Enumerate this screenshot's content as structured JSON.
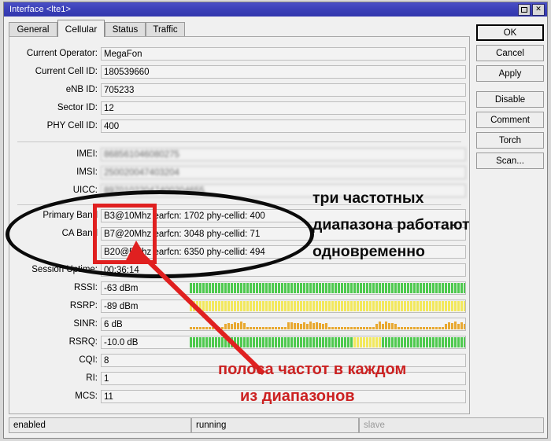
{
  "window": {
    "title": "Interface <lte1>",
    "controls": [
      {
        "name": "maximize",
        "glyph": "□"
      },
      {
        "name": "close",
        "glyph": "✕"
      }
    ]
  },
  "tabs": [
    {
      "label": "General",
      "active": false
    },
    {
      "label": "Cellular",
      "active": true
    },
    {
      "label": "Status",
      "active": false
    },
    {
      "label": "Traffic",
      "active": false
    }
  ],
  "fields": [
    {
      "label": "Current Operator:",
      "value": "MegaFon",
      "blurred": false
    },
    {
      "label": "Current Cell ID:",
      "value": "180539660",
      "blurred": false
    },
    {
      "label": "eNB ID:",
      "value": "705233",
      "blurred": false
    },
    {
      "label": "Sector ID:",
      "value": "12",
      "blurred": false
    },
    {
      "label": "PHY Cell ID:",
      "value": "400",
      "blurred": false
    },
    {
      "label": "IMEI:",
      "value": "868561046080275",
      "blurred": true
    },
    {
      "label": "IMSI:",
      "value": "250020047403204",
      "blurred": true
    },
    {
      "label": "UICC:",
      "value": "89701022047400204655",
      "blurred": true
    }
  ],
  "bands": [
    {
      "label": "Primary Band",
      "value": "B3@10Mhz earfcn: 1702 phy-cellid: 400"
    },
    {
      "label": "CA Band",
      "value": "B7@20Mhz earfcn: 3048 phy-cellid: 71"
    },
    {
      "label": "",
      "value": "B20@5Mhz earfcn: 6350 phy-cellid: 494"
    }
  ],
  "uptime": {
    "label": "Session Uptime:",
    "value": "00:36:14"
  },
  "signals": [
    {
      "label": "RSSI:",
      "value": "-63 dBm",
      "color": "#4ec94e",
      "pattern": "full-green"
    },
    {
      "label": "RSRP:",
      "value": "-89 dBm",
      "color": "#f2e85c",
      "pattern": "full-yellow"
    },
    {
      "label": "SINR:",
      "value": "6 dB",
      "color": "#e8a830",
      "pattern": "sparse-orange"
    },
    {
      "label": "RSRQ:",
      "value": "-10.0 dB",
      "color": "#4ec94e",
      "pattern": "green-with-yellow-gap"
    }
  ],
  "metrics": [
    {
      "label": "CQI:",
      "value": "8"
    },
    {
      "label": "RI:",
      "value": "1"
    },
    {
      "label": "MCS:",
      "value": "11"
    }
  ],
  "buttons": [
    {
      "label": "OK",
      "focused": true,
      "gap": false
    },
    {
      "label": "Cancel",
      "focused": false,
      "gap": false
    },
    {
      "label": "Apply",
      "focused": false,
      "gap": false
    },
    {
      "label": "Disable",
      "focused": false,
      "gap": true
    },
    {
      "label": "Comment",
      "focused": false,
      "gap": false
    },
    {
      "label": "Torch",
      "focused": false,
      "gap": false
    },
    {
      "label": "Scan...",
      "focused": false,
      "gap": false
    }
  ],
  "statusbar": [
    {
      "text": "enabled",
      "dim": false
    },
    {
      "text": "running",
      "dim": false
    },
    {
      "text": "slave",
      "dim": true
    }
  ],
  "annotations": {
    "black_lines": [
      "три частотных",
      "диапазона работают",
      "одновременно"
    ],
    "red_lines": [
      "полоса частот в каждом",
      "из диапазонов"
    ],
    "ellipse_color": "#0b0b0b",
    "rect_color": "#e02020",
    "arrow_color": "#e02020"
  }
}
